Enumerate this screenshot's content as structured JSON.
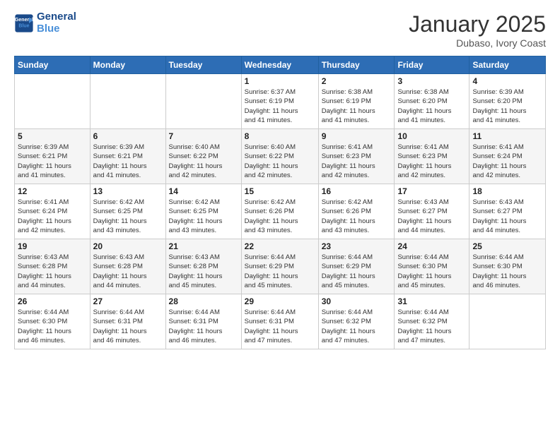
{
  "logo": {
    "line1": "General",
    "line2": "Blue"
  },
  "title": "January 2025",
  "subtitle": "Dubaso, Ivory Coast",
  "days_header": [
    "Sunday",
    "Monday",
    "Tuesday",
    "Wednesday",
    "Thursday",
    "Friday",
    "Saturday"
  ],
  "weeks": [
    [
      {
        "day": "",
        "info": ""
      },
      {
        "day": "",
        "info": ""
      },
      {
        "day": "",
        "info": ""
      },
      {
        "day": "1",
        "info": "Sunrise: 6:37 AM\nSunset: 6:19 PM\nDaylight: 11 hours\nand 41 minutes."
      },
      {
        "day": "2",
        "info": "Sunrise: 6:38 AM\nSunset: 6:19 PM\nDaylight: 11 hours\nand 41 minutes."
      },
      {
        "day": "3",
        "info": "Sunrise: 6:38 AM\nSunset: 6:20 PM\nDaylight: 11 hours\nand 41 minutes."
      },
      {
        "day": "4",
        "info": "Sunrise: 6:39 AM\nSunset: 6:20 PM\nDaylight: 11 hours\nand 41 minutes."
      }
    ],
    [
      {
        "day": "5",
        "info": "Sunrise: 6:39 AM\nSunset: 6:21 PM\nDaylight: 11 hours\nand 41 minutes."
      },
      {
        "day": "6",
        "info": "Sunrise: 6:39 AM\nSunset: 6:21 PM\nDaylight: 11 hours\nand 41 minutes."
      },
      {
        "day": "7",
        "info": "Sunrise: 6:40 AM\nSunset: 6:22 PM\nDaylight: 11 hours\nand 42 minutes."
      },
      {
        "day": "8",
        "info": "Sunrise: 6:40 AM\nSunset: 6:22 PM\nDaylight: 11 hours\nand 42 minutes."
      },
      {
        "day": "9",
        "info": "Sunrise: 6:41 AM\nSunset: 6:23 PM\nDaylight: 11 hours\nand 42 minutes."
      },
      {
        "day": "10",
        "info": "Sunrise: 6:41 AM\nSunset: 6:23 PM\nDaylight: 11 hours\nand 42 minutes."
      },
      {
        "day": "11",
        "info": "Sunrise: 6:41 AM\nSunset: 6:24 PM\nDaylight: 11 hours\nand 42 minutes."
      }
    ],
    [
      {
        "day": "12",
        "info": "Sunrise: 6:41 AM\nSunset: 6:24 PM\nDaylight: 11 hours\nand 42 minutes."
      },
      {
        "day": "13",
        "info": "Sunrise: 6:42 AM\nSunset: 6:25 PM\nDaylight: 11 hours\nand 43 minutes."
      },
      {
        "day": "14",
        "info": "Sunrise: 6:42 AM\nSunset: 6:25 PM\nDaylight: 11 hours\nand 43 minutes."
      },
      {
        "day": "15",
        "info": "Sunrise: 6:42 AM\nSunset: 6:26 PM\nDaylight: 11 hours\nand 43 minutes."
      },
      {
        "day": "16",
        "info": "Sunrise: 6:42 AM\nSunset: 6:26 PM\nDaylight: 11 hours\nand 43 minutes."
      },
      {
        "day": "17",
        "info": "Sunrise: 6:43 AM\nSunset: 6:27 PM\nDaylight: 11 hours\nand 44 minutes."
      },
      {
        "day": "18",
        "info": "Sunrise: 6:43 AM\nSunset: 6:27 PM\nDaylight: 11 hours\nand 44 minutes."
      }
    ],
    [
      {
        "day": "19",
        "info": "Sunrise: 6:43 AM\nSunset: 6:28 PM\nDaylight: 11 hours\nand 44 minutes."
      },
      {
        "day": "20",
        "info": "Sunrise: 6:43 AM\nSunset: 6:28 PM\nDaylight: 11 hours\nand 44 minutes."
      },
      {
        "day": "21",
        "info": "Sunrise: 6:43 AM\nSunset: 6:28 PM\nDaylight: 11 hours\nand 45 minutes."
      },
      {
        "day": "22",
        "info": "Sunrise: 6:44 AM\nSunset: 6:29 PM\nDaylight: 11 hours\nand 45 minutes."
      },
      {
        "day": "23",
        "info": "Sunrise: 6:44 AM\nSunset: 6:29 PM\nDaylight: 11 hours\nand 45 minutes."
      },
      {
        "day": "24",
        "info": "Sunrise: 6:44 AM\nSunset: 6:30 PM\nDaylight: 11 hours\nand 45 minutes."
      },
      {
        "day": "25",
        "info": "Sunrise: 6:44 AM\nSunset: 6:30 PM\nDaylight: 11 hours\nand 46 minutes."
      }
    ],
    [
      {
        "day": "26",
        "info": "Sunrise: 6:44 AM\nSunset: 6:30 PM\nDaylight: 11 hours\nand 46 minutes."
      },
      {
        "day": "27",
        "info": "Sunrise: 6:44 AM\nSunset: 6:31 PM\nDaylight: 11 hours\nand 46 minutes."
      },
      {
        "day": "28",
        "info": "Sunrise: 6:44 AM\nSunset: 6:31 PM\nDaylight: 11 hours\nand 46 minutes."
      },
      {
        "day": "29",
        "info": "Sunrise: 6:44 AM\nSunset: 6:31 PM\nDaylight: 11 hours\nand 47 minutes."
      },
      {
        "day": "30",
        "info": "Sunrise: 6:44 AM\nSunset: 6:32 PM\nDaylight: 11 hours\nand 47 minutes."
      },
      {
        "day": "31",
        "info": "Sunrise: 6:44 AM\nSunset: 6:32 PM\nDaylight: 11 hours\nand 47 minutes."
      },
      {
        "day": "",
        "info": ""
      }
    ]
  ]
}
